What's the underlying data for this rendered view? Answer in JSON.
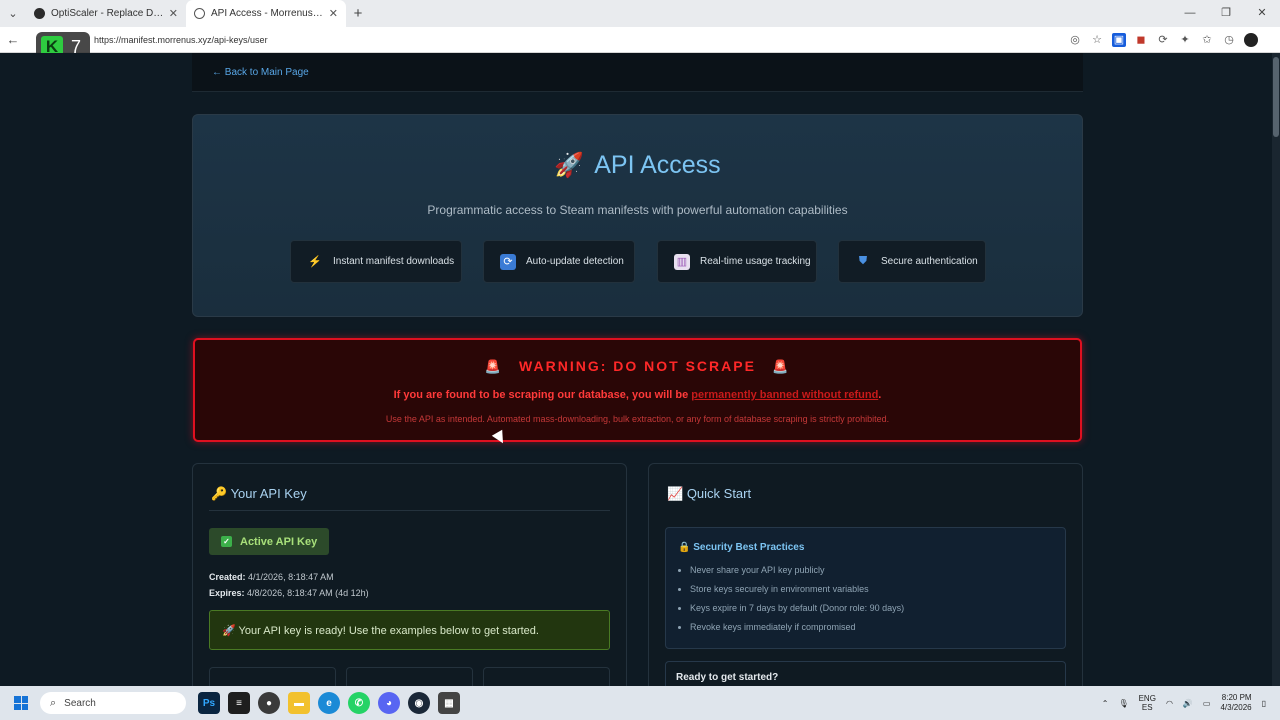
{
  "browser": {
    "tabs": [
      {
        "title": "OptiScaler - Replace DLSS, FSR, X",
        "active": false
      },
      {
        "title": "API Access - Morrenus Games Ma",
        "active": true
      }
    ],
    "new_tab": "+",
    "url": "https://manifest.morrenus.xyz/api-keys/user",
    "overlay_logo": {
      "letter": "K",
      "number": "7"
    }
  },
  "page": {
    "back_link": "← Back to Main Page",
    "hero": {
      "title": "API Access",
      "subtitle": "Programmatic access to Steam manifests with powerful automation capabilities",
      "features": [
        {
          "icon": "lightning-icon",
          "label": "Instant manifest downloads"
        },
        {
          "icon": "refresh-icon",
          "label": "Auto-update detection"
        },
        {
          "icon": "bar-chart-icon",
          "label": "Real-time usage tracking"
        },
        {
          "icon": "shield-icon",
          "label": "Secure authentication"
        }
      ]
    },
    "warning": {
      "title": "WARNING: DO NOT SCRAPE",
      "message_start": "If you are found to be scraping our database, you will be ",
      "message_ban": "permanently banned without refund",
      "message_end": ".",
      "fine_print": "Use the API as intended. Automated mass-downloading, bulk extraction, or any form of database scraping is strictly prohibited."
    },
    "api_key_card": {
      "title": "Your API Key",
      "status": "Active API Key",
      "created_label": "Created:",
      "created_value": "4/1/2026, 8:18:47 AM",
      "expires_label": "Expires:",
      "expires_value": "4/8/2026, 8:18:47 AM (4d 12h)",
      "ready_message": "🚀 Your API key is ready! Use the examples below to get started."
    },
    "quick_start_card": {
      "title": "Quick Start",
      "security_title": "Security Best Practices",
      "security_items": [
        "Never share your API key publicly",
        "Store keys securely in environment variables",
        "Keys expire in 7 days by default (Donor role: 90 days)",
        "Revoke keys immediately if compromised"
      ],
      "ready_title": "Ready to get started?"
    }
  },
  "taskbar": {
    "search_placeholder": "Search",
    "lang": "ENG",
    "region": "ES",
    "time": "8:20 PM",
    "date": "4/3/2026"
  },
  "colors": {
    "accent": "#7cc4f2",
    "warning": "#ff2828",
    "success": "#a8e07a"
  }
}
